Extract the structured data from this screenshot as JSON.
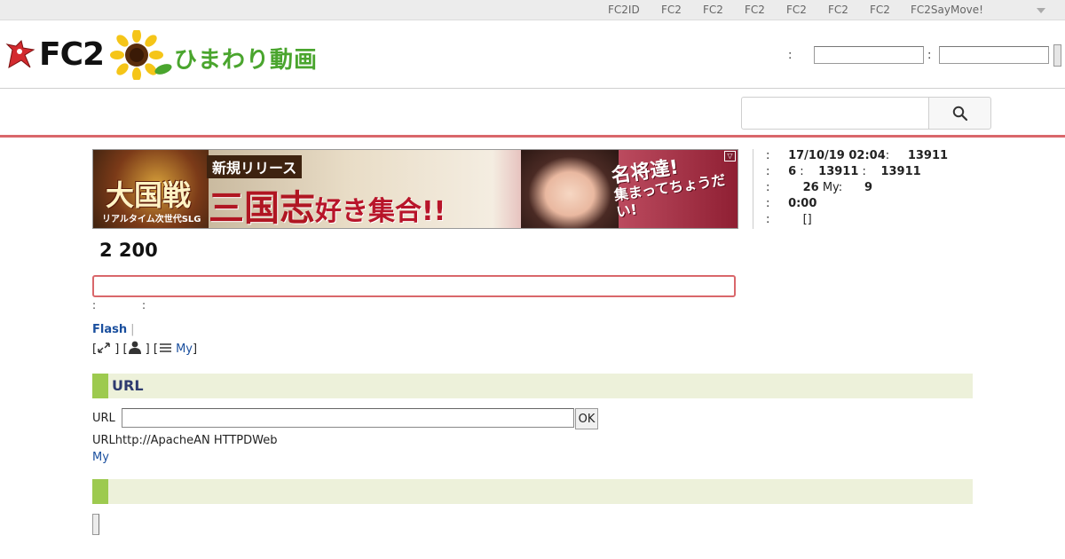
{
  "topbar": {
    "links": [
      "FC2ID",
      "FC2",
      "FC2",
      "FC2",
      "FC2",
      "FC2",
      "FC2",
      "FC2SayMove!"
    ]
  },
  "header": {
    "logo_text": "FC2",
    "logo_sub": "ひまわり動画",
    "login_colon_1": ":",
    "login_colon_2": ":"
  },
  "search": {
    "icon": "search-icon"
  },
  "banner": {
    "left_title": "大国戦",
    "left_sub": "リアルタイム次世代SLG",
    "badge": "新規リリース",
    "main_big": "三国志",
    "main_small": "好き集合!!",
    "right_1": "名将達!",
    "right_2": "集まってちょうだい!",
    "adchoice": "▽"
  },
  "info": {
    "row1": {
      "colon": ":",
      "date": "17/10/19 02:04",
      "colon2": ":",
      "value": "13911"
    },
    "row2": {
      "colon": ":",
      "count": "6",
      "colon2": ":",
      "v1": "13911",
      "colon3": ":",
      "v2": "13911"
    },
    "row3": {
      "colon": ":",
      "count": "26",
      "my_label": "My:",
      "my_value": "9"
    },
    "row4": {
      "colon": ":",
      "time": "0:00"
    },
    "row5": {
      "colon": ":",
      "value": "[]"
    }
  },
  "main": {
    "title": "2 200",
    "meta_colon_1": ":",
    "meta_colon_2": ":",
    "flash_label": "Flash",
    "flash_sep": "|",
    "bracket_open": "[",
    "bracket_close": "]",
    "my_link": "My"
  },
  "url_section": {
    "heading": "URL",
    "field_label": "URL",
    "ok_label": "OK",
    "description": "URLhttp://ApacheAN HTTPDWeb",
    "my_link": "My"
  },
  "second_section": {
    "heading": ""
  },
  "colors": {
    "accent_red": "#d9676b",
    "section_bg": "#edf1da",
    "section_mark": "#9dca4f",
    "link_blue": "#1a4f9e",
    "heading_blue": "#2e3b6f"
  }
}
